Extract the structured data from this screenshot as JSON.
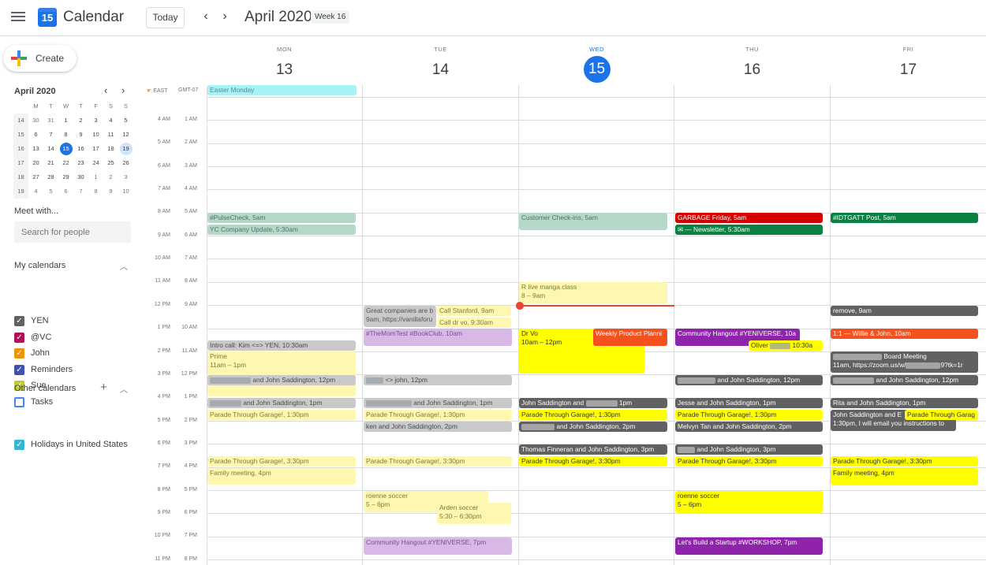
{
  "header": {
    "app_name": "Calendar",
    "logo_day": "15",
    "today_label": "Today",
    "prev_icon": "‹",
    "next_icon": "›",
    "month_title": "April 2020",
    "week_badge": "Week 16"
  },
  "sidebar": {
    "create_label": "Create",
    "mini": {
      "title": "April 2020",
      "weekdays": [
        "M",
        "T",
        "W",
        "T",
        "F",
        "S",
        "S"
      ],
      "weeks": [
        {
          "wk": "14",
          "days": [
            "30",
            "31",
            "1",
            "2",
            "3",
            "4",
            "5"
          ]
        },
        {
          "wk": "15",
          "days": [
            "6",
            "7",
            "8",
            "9",
            "10",
            "11",
            "12"
          ]
        },
        {
          "wk": "16",
          "days": [
            "13",
            "14",
            "15",
            "16",
            "17",
            "18",
            "19"
          ]
        },
        {
          "wk": "17",
          "days": [
            "20",
            "21",
            "22",
            "23",
            "24",
            "25",
            "26"
          ]
        },
        {
          "wk": "18",
          "days": [
            "27",
            "28",
            "29",
            "30",
            "1",
            "2",
            "3"
          ]
        },
        {
          "wk": "19",
          "days": [
            "4",
            "5",
            "6",
            "7",
            "8",
            "9",
            "10"
          ]
        }
      ],
      "today": "15",
      "selected": "19"
    },
    "meet_title": "Meet with...",
    "search_placeholder": "Search for people",
    "my_calendars_title": "My calendars",
    "my_calendars": [
      {
        "name": "YEN",
        "color": "#616161",
        "checked": true
      },
      {
        "name": "@VC",
        "color": "#ad1457",
        "checked": true
      },
      {
        "name": "John",
        "color": "#f09300",
        "checked": true
      },
      {
        "name": "Reminders",
        "color": "#3f51b5",
        "checked": true
      },
      {
        "name": "Sue",
        "color": "#c0ca33",
        "checked": true
      },
      {
        "name": "Tasks",
        "color": "#4285f4",
        "checked": false
      }
    ],
    "other_calendars_title": "Other calendars",
    "other_calendars": [
      {
        "name": "Holidays in United States",
        "color": "#33b6d4",
        "checked": true
      }
    ]
  },
  "timezones": {
    "left": "EAST",
    "right": "GMT-07"
  },
  "hours": [
    {
      "left": "4 AM",
      "right": "1 AM"
    },
    {
      "left": "5 AM",
      "right": "2 AM"
    },
    {
      "left": "6 AM",
      "right": "3 AM"
    },
    {
      "left": "7 AM",
      "right": "4 AM"
    },
    {
      "left": "8 AM",
      "right": "5 AM"
    },
    {
      "left": "9 AM",
      "right": "6 AM"
    },
    {
      "left": "10 AM",
      "right": "7 AM"
    },
    {
      "left": "11 AM",
      "right": "8 AM"
    },
    {
      "left": "12 PM",
      "right": "9 AM"
    },
    {
      "left": "1 PM",
      "right": "10 AM"
    },
    {
      "left": "2 PM",
      "right": "11 AM"
    },
    {
      "left": "3 PM",
      "right": "12 PM"
    },
    {
      "left": "4 PM",
      "right": "1 PM"
    },
    {
      "left": "5 PM",
      "right": "2 PM"
    },
    {
      "left": "6 PM",
      "right": "3 PM"
    },
    {
      "left": "7 PM",
      "right": "4 PM"
    },
    {
      "left": "8 PM",
      "right": "5 PM"
    },
    {
      "left": "9 PM",
      "right": "6 PM"
    },
    {
      "left": "10 PM",
      "right": "7 PM"
    },
    {
      "left": "11 PM",
      "right": "8 PM"
    }
  ],
  "days": [
    {
      "name": "MON",
      "date": "13"
    },
    {
      "name": "TUE",
      "date": "14"
    },
    {
      "name": "WED",
      "date": "15",
      "today": true
    },
    {
      "name": "THU",
      "date": "16"
    },
    {
      "name": "FRI",
      "date": "17"
    }
  ],
  "colors": {
    "today_blue": "#1a73e8",
    "now_line": "#ea4335",
    "gray": "#616161",
    "light_gray": "#c9c9c9",
    "pale_yellow": "#fdf7b0",
    "yellow": "#ffff00",
    "teal": "#b5d8c9",
    "cyan": "#a5f2f7",
    "lavender": "#d8b8e6",
    "purple": "#8e24aa",
    "red": "#d50000",
    "orange": "#f4511e",
    "green": "#0b8043"
  },
  "events": {
    "mon_easter": "Easter Monday",
    "mon_pulse": "#PulseCheck, 5am",
    "mon_yc": "YC Company Update, 5:30am",
    "mon_intro": "Intro call: Kim <=> YEN, 10:30am",
    "mon_prime_1": "Prime",
    "mon_prime_2": "11am – 1pm",
    "mon_jsadd1": "and John Saddington, 12pm",
    "mon_jsadd2": "and John Saddington, 1pm",
    "mon_parade1": "Parade Through Garage!, 1:30pm",
    "mon_parade2": "Parade Through Garage!, 3:30pm",
    "mon_family": "Family meeting, 4pm",
    "tue_great_1": "Great companies are b",
    "tue_great_2": "9am, https://vanillaforu",
    "tue_stanford": "Call Stanford, 9am",
    "tue_drvo": "Call dr vo, 9:30am",
    "tue_mom": "#TheMomTest #BookClub, 10am",
    "tue_john": "<> john, 12pm",
    "tue_jsadd": "and John Saddington, 1pm",
    "tue_parade1": "Parade Through Garage!, 1:30pm",
    "tue_ken": "ken and John Saddington, 2pm",
    "tue_parade2": "Parade Through Garage!, 3:30pm",
    "tue_roenne_1": "roenne soccer",
    "tue_roenne_2": "5 – 6pm",
    "tue_arden_1": "Arden soccer",
    "tue_arden_2": "5:30 – 6:30pm",
    "tue_hangout": "Community Hangout #YENIVERSE, 7pm",
    "wed_checkins": "Customer Check-ins, 5am",
    "wed_manga_1": "R live manga class",
    "wed_manga_2": "8 – 9am",
    "wed_drvo_1": "Dr Vo",
    "wed_drvo_2": "10am – 12pm",
    "wed_weekly": "Weekly Product Planni",
    "wed_js1": "John Saddington and",
    "wed_js1b": "1pm",
    "wed_parade1": "Parade Through Garage!, 1:30pm",
    "wed_js2": "and John Saddington, 2pm",
    "wed_thomas": "Thomas Finneran and John Saddington, 3pm",
    "wed_parade2": "Parade Through Garage!, 3:30pm",
    "thu_garbage": "GARBAGE Friday, 5am",
    "thu_newsletter": "— Newsletter, 5:30am",
    "thu_hangout": "Community Hangout #YENIVERSE, 10a",
    "thu_oliver": "Oliver",
    "thu_oliver_b": "10:30a",
    "thu_js1": "and John Saddington, 12pm",
    "thu_jesse": "Jesse and John Saddington, 1pm",
    "thu_parade1": "Parade Through Garage!, 1:30pm",
    "thu_melvyn": "Melvyn Tan and John Saddington, 2pm",
    "thu_js2": "and John Saddington, 3pm",
    "thu_parade2": "Parade Through Garage!, 3:30pm",
    "thu_roenne_1": "roenne soccer",
    "thu_roenne_2": "5 – 6pm",
    "thu_startup": "Let's Build a Startup #WORKSHOP, 7pm",
    "fri_idtgatt": "#IDTGATT Post, 5am",
    "fri_remove": "remove, 9am",
    "fri_willie": "1:1 — Willie & John, 10am",
    "fri_board_1": "Board Meeting",
    "fri_board_2": "11am, https://zoom.us/w/",
    "fri_board_3": "9?tk=1r",
    "fri_js1": "and John Saddington, 12pm",
    "fri_rita": "Rita and John Saddington, 1pm",
    "fri_js2_1": "John Saddington and E",
    "fri_js2_2": "1:30pm, I will email you instructions to",
    "fri_parade1": "Parade Through Garag",
    "fri_parade2": "Parade Through Garage!, 3:30pm",
    "fri_family": "Family meeting, 4pm"
  }
}
